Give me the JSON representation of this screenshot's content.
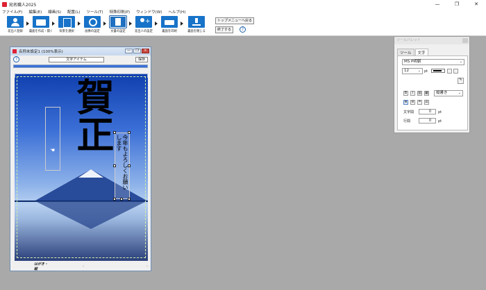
{
  "window": {
    "title": "宛名職人2025",
    "minimize": "—",
    "restore": "❐",
    "close": "✕"
  },
  "menu": [
    "ファイル(F)",
    "編集(E)",
    "線画(S)",
    "配置(L)",
    "ツール(T)",
    "特殊印刷(P)",
    "ウィンドウ(W)",
    "ヘルプ(H)"
  ],
  "toolbar": {
    "buttons": [
      {
        "label": "差出人登録",
        "icon": "person-icon"
      },
      {
        "label": "裏面を作成・開く",
        "icon": "folder-icon"
      },
      {
        "label": "背景を選択",
        "icon": "photo-icon"
      },
      {
        "label": "画像の設定",
        "icon": "image-settings-icon"
      },
      {
        "label": "文書の設定",
        "icon": "document-settings-icon"
      },
      {
        "label": "差出人の設定",
        "icon": "add-person-icon"
      },
      {
        "label": "裏面を印刷",
        "icon": "printer-icon"
      },
      {
        "label": "裏面を閉じる",
        "icon": "download-icon"
      }
    ],
    "top_menu_label": "トップメニューへ戻る",
    "exit_label": "終了する",
    "help_label": "?"
  },
  "document": {
    "title": "名称未設定1 (100%表示)",
    "help_label": "?",
    "field_label": "文字アイテム",
    "save_label": "保存",
    "progress": 1.0,
    "greeting": "賀正",
    "message": "今年もよろしくお願いします",
    "status_name": "はがき・縦",
    "scroll_left": "‹",
    "scroll_right": "›"
  },
  "palette": {
    "title": "ツールパレット",
    "tabs": [
      "ツール",
      "文字"
    ],
    "font": "MS P明朝",
    "size": "12",
    "size_unit": "pt",
    "bold": "B",
    "italic": "I",
    "direction": "縦書き",
    "char_spacing_label": "文字間",
    "char_spacing": "0",
    "line_spacing_label": "行間",
    "line_spacing": "0",
    "unit": "pt"
  },
  "colors": {
    "accent": "#1873c9",
    "progress": "#3a70d8",
    "titlebar_close": "#c9463d"
  }
}
